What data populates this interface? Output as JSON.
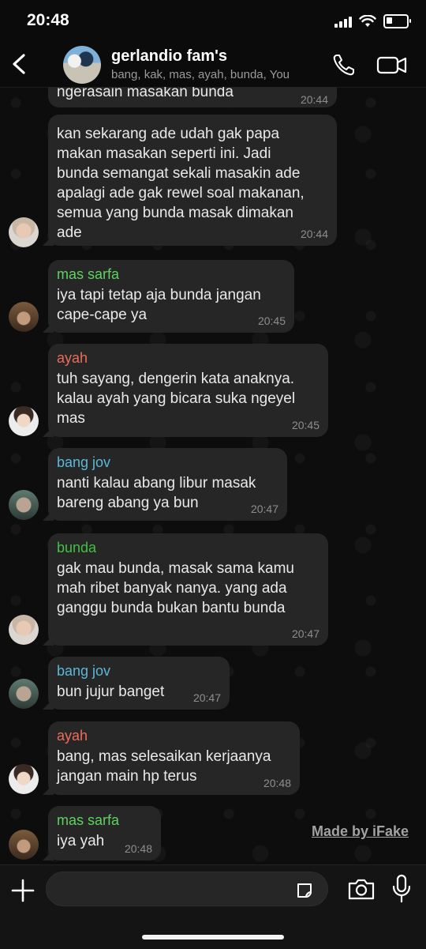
{
  "status_bar": {
    "time": "20:48",
    "battery_level": 0.3
  },
  "header": {
    "group_name": "gerlandio fam's",
    "members": "bang, kak, mas, ayah, bunda, You"
  },
  "colors": {
    "mas_sarfa": "#5fd35f",
    "ayah": "#ef6b5b",
    "bang_jov": "#5bb8d8",
    "bunda": "#42c142"
  },
  "messages": [
    {
      "sender": "",
      "text": "ngerasain masakan bunda",
      "time": "20:44"
    },
    {
      "sender": "",
      "text": "kan sekarang ade udah gak papa\nmakan masakan seperti ini. Jadi\nbunda semangat sekali masakin ade\napalagi ade gak rewel soal makanan,\nsemua yang bunda masak dimakan\nade",
      "time": "20:44"
    },
    {
      "sender": "mas sarfa",
      "text": "iya tapi tetap aja bunda jangan\ncape-cape ya",
      "time": "20:45"
    },
    {
      "sender": "ayah",
      "text": "tuh sayang, dengerin kata anaknya.\nkalau ayah yang bicara suka ngeyel\nmas",
      "time": "20:45"
    },
    {
      "sender": "bang jov",
      "text": "nanti kalau abang libur masak\nbareng abang ya bun",
      "time": "20:47"
    },
    {
      "sender": "bunda",
      "text": "gak mau bunda, masak sama kamu\nmah ribet banyak nanya. yang ada\nganggu bunda bukan bantu bunda",
      "time": "20:47"
    },
    {
      "sender": "bang jov",
      "text": "bun jujur banget",
      "time": "20:47"
    },
    {
      "sender": "ayah",
      "text": "bang, mas selesaikan kerjaanya\njangan main hp terus",
      "time": "20:48"
    },
    {
      "sender": "mas sarfa",
      "text": "iya yah",
      "time": "20:48"
    }
  ],
  "watermark": "Made by iFake",
  "input": {
    "placeholder": ""
  }
}
